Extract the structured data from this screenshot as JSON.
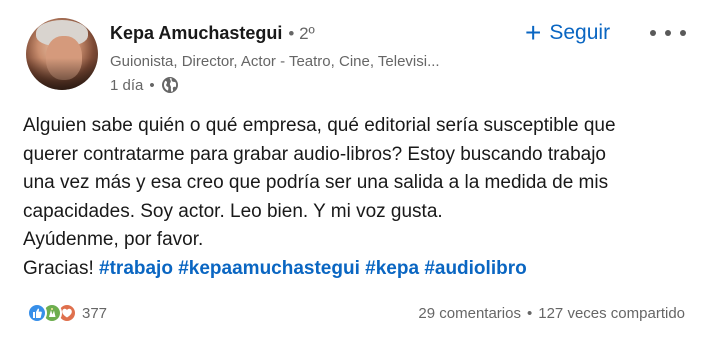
{
  "author": {
    "name": "Kepa Amuchastegui",
    "separator": "•",
    "degree": "2º",
    "headline": "Guionista, Director, Actor - Teatro, Cine, Televisi...",
    "time": "1 día",
    "time_separator": "•",
    "visibility_icon": "globe-icon"
  },
  "actions": {
    "follow_icon": "plus-icon",
    "follow_plus": "+",
    "follow_label": "Seguir",
    "more_icon": "more-horizontal-icon"
  },
  "post": {
    "lines": [
      "Alguien sabe quién o qué empresa, qué editorial sería susceptible que",
      "querer contratarme para grabar audio-libros? Estoy buscando trabajo",
      "una vez más y esa creo que podría ser una salida a la medida de mis",
      "capacidades. Soy actor. Leo bien. Y mi voz gusta.",
      "Ayúdenme, por favor."
    ],
    "last_line_prefix": "Gracias! ",
    "hashtags": [
      "#trabajo",
      "#kepaamuchastegui",
      "#kepa",
      "#audiolibro"
    ]
  },
  "social": {
    "reaction_icons": [
      "like-icon",
      "celebrate-icon",
      "love-icon"
    ],
    "reactions_count": "377",
    "comments": "29 comentarios",
    "separator": "•",
    "shares": "127 veces compartido"
  },
  "colors": {
    "accent": "#0a66c2",
    "text": "#191919",
    "muted": "#666666",
    "like": "#378fe9",
    "celebrate": "#6dae4f",
    "love": "#df704d"
  }
}
